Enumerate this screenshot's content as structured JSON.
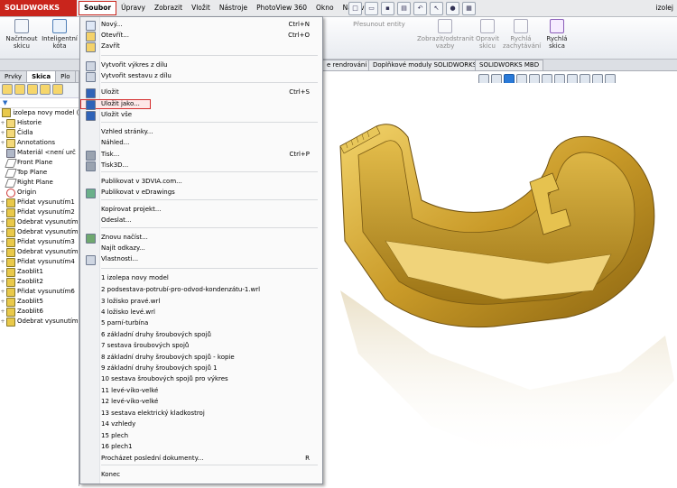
{
  "app": {
    "logo": "SOLIDWORKS",
    "title_right": "izolej"
  },
  "menubar": [
    "Soubor",
    "Úpravy",
    "Zobrazit",
    "Vložit",
    "Nástroje",
    "PhotoView 360",
    "Okno",
    "Nápověda"
  ],
  "ribbon": {
    "sketch": "Načrtnout skicu",
    "smart_dim": "Inteligentní kóta",
    "move_entities": "Přesunout entity",
    "show_hide": "Zobrazit/odstranit vazby",
    "repair": "Opravit skicu",
    "quick_snaps": "Rychlá zachytávání",
    "rapid_sketch": "Rychlá skica"
  },
  "tabs": [
    "e rendrování",
    "Doplňkové moduly SOLIDWORKS",
    "SOLIDWORKS MBD"
  ],
  "panel": {
    "tabs": [
      "Prvky",
      "Skica",
      "Plo"
    ],
    "root": "izolepa novy model  (",
    "items": [
      "Historie",
      "Čidla",
      "Annotations",
      "Materiál <není urč",
      "Front Plane",
      "Top Plane",
      "Right Plane",
      "Origin",
      "Přidat vysunutím1",
      "Přidat vysunutím2",
      "Odebrat vysunutím",
      "Odebrat vysunutím",
      "Přidat vysunutím3",
      "Odebrat vysunutím",
      "Přidat vysunutím4",
      "Zaoblit1",
      "Zaoblit2",
      "Přidat vysunutím6",
      "Zaoblit5",
      "Zaoblit6",
      "Odebrat vysunutím"
    ]
  },
  "file_menu": {
    "items": [
      {
        "label": "Nový...",
        "shortcut": "Ctrl+N"
      },
      {
        "label": "Otevřít...",
        "shortcut": "Ctrl+O"
      },
      {
        "label": "Zavřít",
        "shortcut": ""
      },
      {
        "label": "Vytvořit výkres z dílu",
        "shortcut": ""
      },
      {
        "label": "Vytvořit sestavu z dílu",
        "shortcut": ""
      },
      {
        "label": "Uložit",
        "shortcut": "Ctrl+S"
      },
      {
        "label": "Uložit jako...",
        "shortcut": ""
      },
      {
        "label": "Uložit vše",
        "shortcut": ""
      },
      {
        "label": "Vzhled stránky...",
        "shortcut": ""
      },
      {
        "label": "Náhled...",
        "shortcut": ""
      },
      {
        "label": "Tisk...",
        "shortcut": "Ctrl+P"
      },
      {
        "label": "Tisk3D...",
        "shortcut": ""
      },
      {
        "label": "Publikovat v 3DVIA.com...",
        "shortcut": ""
      },
      {
        "label": "Publikovat v eDrawings",
        "shortcut": ""
      },
      {
        "label": "Kopírovat projekt...",
        "shortcut": ""
      },
      {
        "label": "Odeslat...",
        "shortcut": ""
      },
      {
        "label": "Znovu načíst...",
        "shortcut": ""
      },
      {
        "label": "Najít odkazy...",
        "shortcut": ""
      },
      {
        "label": "Vlastnosti...",
        "shortcut": ""
      },
      {
        "label": "1 izolepa novy model",
        "shortcut": ""
      },
      {
        "label": "2 podsestava-potrubí-pro-odvod-kondenzátu-1.wrl",
        "shortcut": ""
      },
      {
        "label": "3 ložisko pravé.wrl",
        "shortcut": ""
      },
      {
        "label": "4 ložisko levé.wrl",
        "shortcut": ""
      },
      {
        "label": "5 parní-turbína",
        "shortcut": ""
      },
      {
        "label": "6 základní druhy šroubových spojů",
        "shortcut": ""
      },
      {
        "label": "7 sestava šroubových spojů",
        "shortcut": ""
      },
      {
        "label": "8 základní druhy šroubových spojů - kopie",
        "shortcut": ""
      },
      {
        "label": "9 základní druhy šroubových spojů 1",
        "shortcut": ""
      },
      {
        "label": "10 sestava šroubových spojů pro výkres",
        "shortcut": ""
      },
      {
        "label": "11 levé-víko-velké",
        "shortcut": ""
      },
      {
        "label": "12 levé-víko-velké",
        "shortcut": ""
      },
      {
        "label": "13 sestava elektrický kladkostroj",
        "shortcut": ""
      },
      {
        "label": "14 vzhledy",
        "shortcut": ""
      },
      {
        "label": "15 plech",
        "shortcut": ""
      },
      {
        "label": "16 plech1",
        "shortcut": ""
      },
      {
        "label": "Procházet poslední dokumenty...",
        "shortcut": "R"
      },
      {
        "label": "Konec",
        "shortcut": ""
      }
    ]
  },
  "colors": {
    "accent": "#c9251c",
    "model": "#c9a030"
  }
}
